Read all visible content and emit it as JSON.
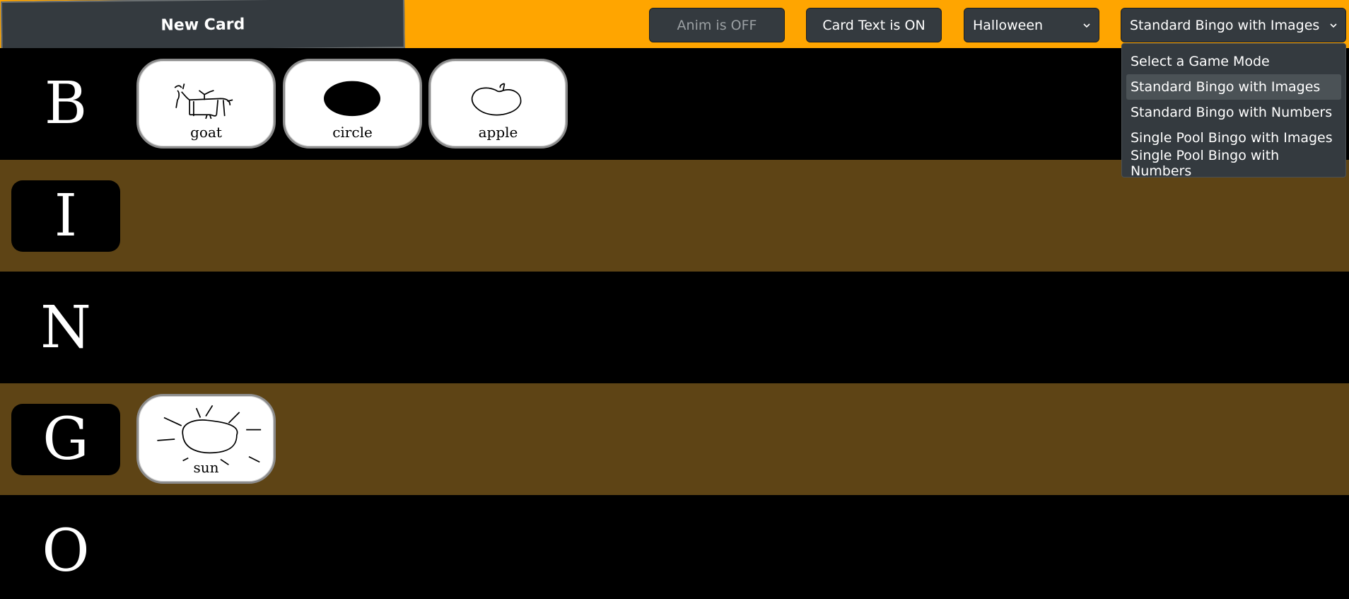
{
  "toolbar": {
    "new_card_label": "New Card",
    "anim_label": "Anim is OFF",
    "card_text_label": "Card Text is ON",
    "theme_selected": "Halloween",
    "mode_selected": "Standard Bingo with Images"
  },
  "mode_dropdown": {
    "options": [
      "Select a Game Mode",
      "Standard Bingo with Images",
      "Standard Bingo with Numbers",
      "Single Pool Bingo with Images",
      "Single Pool Bingo with Numbers"
    ],
    "highlighted_index": 1
  },
  "board": {
    "rows": [
      {
        "letter": "B",
        "cards": [
          {
            "label": "goat",
            "icon": "goat-icon"
          },
          {
            "label": "circle",
            "icon": "circle-icon"
          },
          {
            "label": "apple",
            "icon": "apple-icon"
          }
        ]
      },
      {
        "letter": "I",
        "cards": []
      },
      {
        "letter": "N",
        "cards": []
      },
      {
        "letter": "G",
        "cards": [
          {
            "label": "sun",
            "icon": "sun-icon"
          }
        ]
      },
      {
        "letter": "O",
        "cards": []
      }
    ]
  },
  "colors": {
    "topbar": "#ffa500",
    "row_dark": "#000000",
    "row_brown": "#5e4415",
    "button_bg": "#343a3f"
  }
}
